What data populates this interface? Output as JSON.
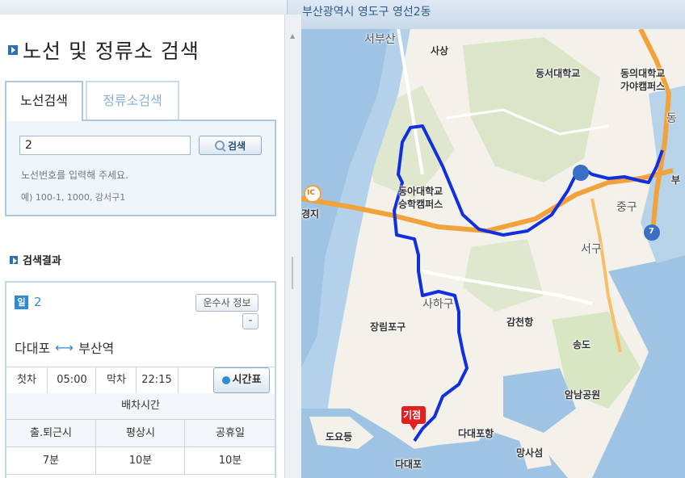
{
  "header": {
    "location": "부산광역시 영도구 영선2동"
  },
  "panel": {
    "title": "노선 및 정류소 검색",
    "tabs": [
      {
        "label": "노선검색",
        "active": true
      },
      {
        "label": "정류소검색",
        "active": false
      }
    ],
    "search": {
      "value": "2",
      "button_label": "검색",
      "hint": "노선번호를 입력해 주세요.",
      "example": "예) 100-1, 1000, 강서구1"
    },
    "results_title": "검색결과",
    "result": {
      "badge": "일",
      "route_number": "2",
      "company_button": "운수사 정보",
      "collapse_button": "-",
      "origin": "다대포",
      "destination": "부산역",
      "first_label": "첫차",
      "first_time": "05:00",
      "last_label": "막차",
      "last_time": "22:15",
      "timetable_button": "시간표",
      "interval_title": "배차시간",
      "interval_headers": [
        "출.퇴근시",
        "평상시",
        "공휴일"
      ],
      "interval_values": [
        "7분",
        "10분",
        "10분"
      ]
    }
  },
  "map": {
    "labels": {
      "seobusan": "서부산",
      "sasang": "사상",
      "dongseo_univ": "동서대학교",
      "dongeui_univ": "동의대학교",
      "gaya_campus": "가야캠퍼스",
      "dong": "동",
      "donga_univ": "동아대학교",
      "seunghak_campus": "승학캠퍼스",
      "gyeongji": "경지",
      "junggu": "중구",
      "bu": "부",
      "seogu": "서구",
      "sahagu": "사하구",
      "jangnimpogu": "장림포구",
      "gamcheonhang": "감천항",
      "songdo": "송도",
      "amnam_park": "암남공원",
      "start_marker": "기점",
      "doyodeung": "도요등",
      "dadaepohang": "다대포항",
      "mangsaseom": "망사섬",
      "dadaepo": "다대포",
      "ic": "IC",
      "route7": "7"
    },
    "colors": {
      "route": "#1030e0",
      "water": "#9fc3e3",
      "highway": "#f2a23a",
      "land": "#f3f1ea",
      "park": "#d8e6c4"
    }
  }
}
